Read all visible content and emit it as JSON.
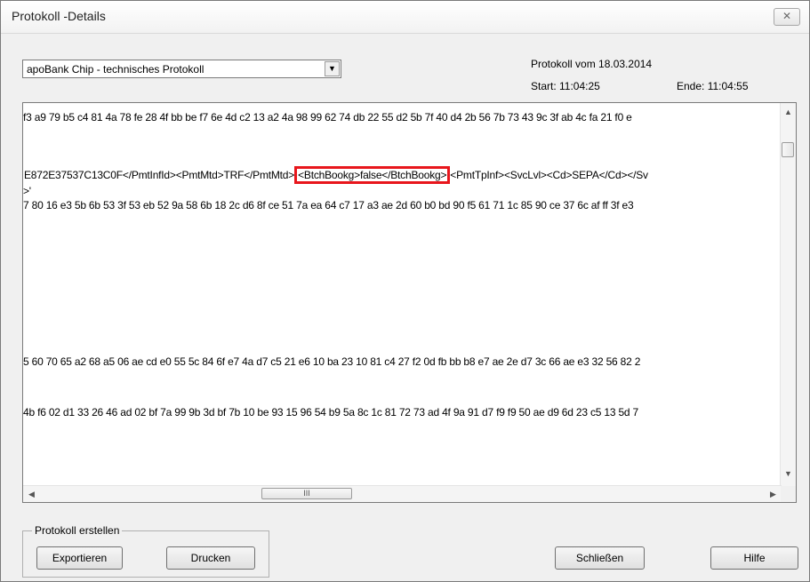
{
  "window": {
    "title": "Protokoll -Details",
    "close_glyph": "✕"
  },
  "protocol_select": {
    "value": "apoBank Chip - technisches Protokoll"
  },
  "info": {
    "protokoll_vom": "Protokoll vom  18.03.2014",
    "start": "Start:  11:04:25",
    "ende": "Ende:  11:04:55"
  },
  "log": {
    "line1": "f3 a9 79 b5 c4 81 4a 78 fe 28 4f bb be f7 6e 4d c2 13 a2 4a 98 99 62 74 db 22 55 d2 5b 7f 40 d4 2b 56 7b 73 43 9c 3f ab 4c fa 21 f0 e",
    "line2_before": "E872E37537C13C0F</PmtInfId><PmtMtd>TRF</PmtMtd>",
    "line2_highlight": "<BtchBookg>false</BtchBookg>",
    "line2_after": "<PmtTpInf><SvcLvl><Cd>SEPA</Cd></Sv",
    "line3": ">'",
    "line4": "7 80 16 e3 5b 6b 53 3f 53 eb 52 9a 58 6b 18 2c d6 8f ce 51 7a ea 64 c7 17 a3 ae 2d 60 b0 bd 90 f5 61 71 1c 85 90 ce 37 6c af ff 3f e3",
    "line5": "5 60 70 65 a2 68 a5 06 ae cd e0 55 5c 84 6f e7 4a d7 c5 21 e6 10 ba 23 10 81 c4 27 f2 0d fb bb b8 e7 ae 2e d7 3c 66 ae e3 32 56 82 2",
    "line6": "4b f6 02 d1 33 26 46 ad 02 bf 7a 99 9b 3d bf 7b 10 be 93 15 96 54 b9 5a 8c 1c 81 72 73 ad 4f 9a 91 d7 f9 f9 50 ae d9 6d 23 c5 13 5d 7"
  },
  "scrollbar": {
    "thumb_grip": "III"
  },
  "group": {
    "label": "Protokoll erstellen"
  },
  "buttons": {
    "export": "Exportieren",
    "print": "Drucken",
    "close": "Schließen",
    "help": "Hilfe"
  },
  "colors": {
    "highlight_border": "#e8161c",
    "window_bg": "#f0f0f0"
  }
}
